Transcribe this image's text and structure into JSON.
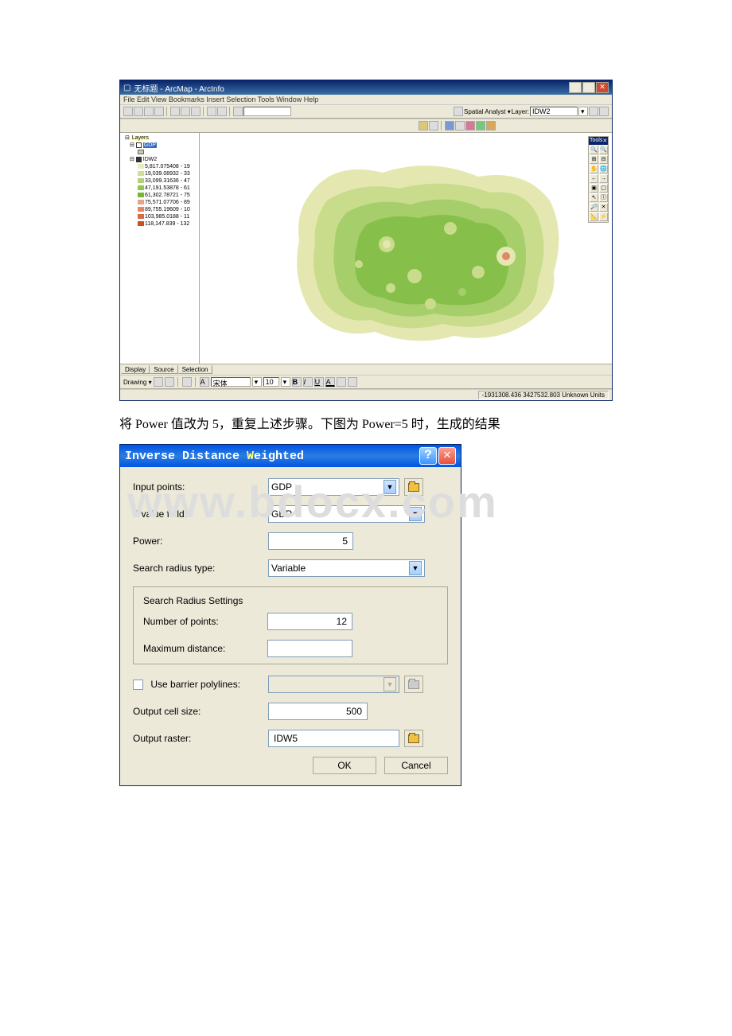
{
  "arcmap": {
    "title": "无标题 - ArcMap - ArcInfo",
    "menubar": "File Edit View Bookmarks Insert Selection Tools Window Help",
    "spatial_analyst_label": "Spatial Analyst ▾",
    "layer_label": "Layer:",
    "layer_value": "IDW2",
    "toc": {
      "layers_label": "Layers",
      "gdp_label": "GDP",
      "idw_label": "IDW2",
      "classes": [
        {
          "range": "5,817.075408 - 19",
          "color": "#e9ecbc"
        },
        {
          "range": "19,039.08932 - 33",
          "color": "#cdde9a"
        },
        {
          "range": "33,099.31636 - 47",
          "color": "#b0d178"
        },
        {
          "range": "47,191.53878 - 61",
          "color": "#93c356"
        },
        {
          "range": "61,302.78721 - 75",
          "color": "#76b634"
        },
        {
          "range": "75,571.07706 - 89",
          "color": "#e9a38d"
        },
        {
          "range": "89,755.19609 - 10",
          "color": "#e0876a"
        },
        {
          "range": "103,985.0188 - 11",
          "color": "#d66b47"
        },
        {
          "range": "118,147.839 - 132",
          "color": "#cc4f24"
        }
      ]
    },
    "tabs": {
      "display": "Display",
      "source": "Source",
      "selection": "Selection"
    },
    "drawing_label": "Drawing ▾",
    "tools_title": "Tools",
    "tools_close": "✕",
    "status": "-1931308.436  3427532.803 Unknown Units"
  },
  "caption": "将 Power 值改为 5，重复上述步骤。下图为 Power=5 时，生成的结果",
  "watermark": "www.bdocx.com",
  "idw": {
    "title_white": "Inverse Distance ",
    "title_w": "W",
    "title_rest": "eighted",
    "input_points_label": "Input points:",
    "input_points_value": "GDP",
    "z_field_label": "Z value field:",
    "z_field_value": "GDP",
    "power_label": "Power:",
    "power_value": "5",
    "search_type_label": "Search radius type:",
    "search_type_value": "Variable",
    "fieldset_legend": "Search Radius Settings",
    "num_points_label": "Number of points:",
    "num_points_value": "12",
    "max_dist_label": "Maximum distance:",
    "max_dist_value": "",
    "barrier_label": "Use barrier polylines:",
    "cell_size_label": "Output cell size:",
    "cell_size_value": "500",
    "output_raster_label": "Output raster:",
    "output_raster_value": "IDW5",
    "ok_btn": "OK",
    "cancel_btn": "Cancel"
  }
}
